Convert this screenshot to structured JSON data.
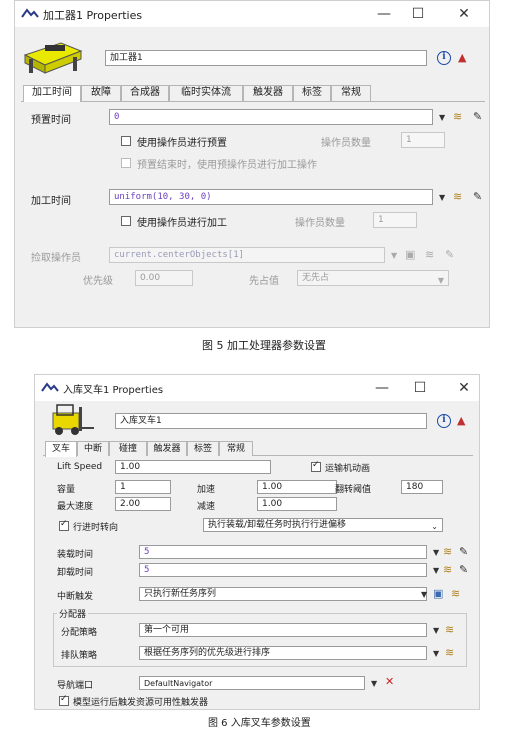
{
  "fig1": {
    "window_title": "加工器1  Properties",
    "name_value": "加工器1",
    "tabs": [
      "加工时间",
      "故障",
      "合成器",
      "临时实体流",
      "触发器",
      "标签",
      "常规"
    ],
    "preset_label": "预置时间",
    "preset_value": "0",
    "use_operator_preset": "使用操作员进行预置",
    "operator_count_label": "操作员数量",
    "operator_count_value": "1",
    "preset_end_label": "预置结束时，使用预操作员进行加工操作",
    "process_label": "加工时间",
    "process_value": "uniform(10, 30, 0)",
    "use_operator_process": "使用操作员进行加工",
    "operator_count_label2": "操作员数量",
    "operator_count_value2": "1",
    "pick_operator_label": "捡取操作员",
    "pick_operator_value": "current.centerObjects[1]",
    "priority_label": "优先级",
    "priority_value": "0.00",
    "preempt_label": "先占值",
    "preempt_value": "无先占",
    "caption": "图 5  加工处理器参数设置"
  },
  "fig2": {
    "window_title": "入库叉车1  Properties",
    "name_value": "入库叉车1",
    "tabs": [
      "叉车",
      "中断",
      "碰撞",
      "触发器",
      "标签",
      "常规"
    ],
    "lift_speed_label": "Lift Speed",
    "lift_speed_value": "1.00",
    "transport_anim_label": "运输机动画",
    "capacity_label": "容量",
    "capacity_value": "1",
    "accel_label": "加速",
    "accel_value": "1.00",
    "flip_threshold_label": "翻转阈值",
    "flip_threshold_value": "180",
    "max_speed_label": "最大速度",
    "max_speed_value": "2.00",
    "decel_label": "减速",
    "decel_value": "1.00",
    "turn_while_moving_label": "行进时转向",
    "offset_option": "执行装载/卸载任务时执行行进偏移",
    "load_time_label": "装载时间",
    "load_time_value": "5",
    "unload_time_label": "卸载时间",
    "unload_time_value": "5",
    "break_trigger_label": "中断触发",
    "break_trigger_value": "只执行新任务序列",
    "dispatcher_label": "分配器",
    "dispatch_policy_label": "分配策略",
    "dispatch_policy_value": "第一个可用",
    "queue_strategy_label": "排队策略",
    "queue_strategy_value": "根据任务序列的优先级进行排序",
    "nav_port_label": "导航端口",
    "nav_port_value": "DefaultNavigator",
    "model_run_label": "模型运行后触发资源可用性触发器",
    "caption": "图 6  入库叉车参数设置"
  }
}
